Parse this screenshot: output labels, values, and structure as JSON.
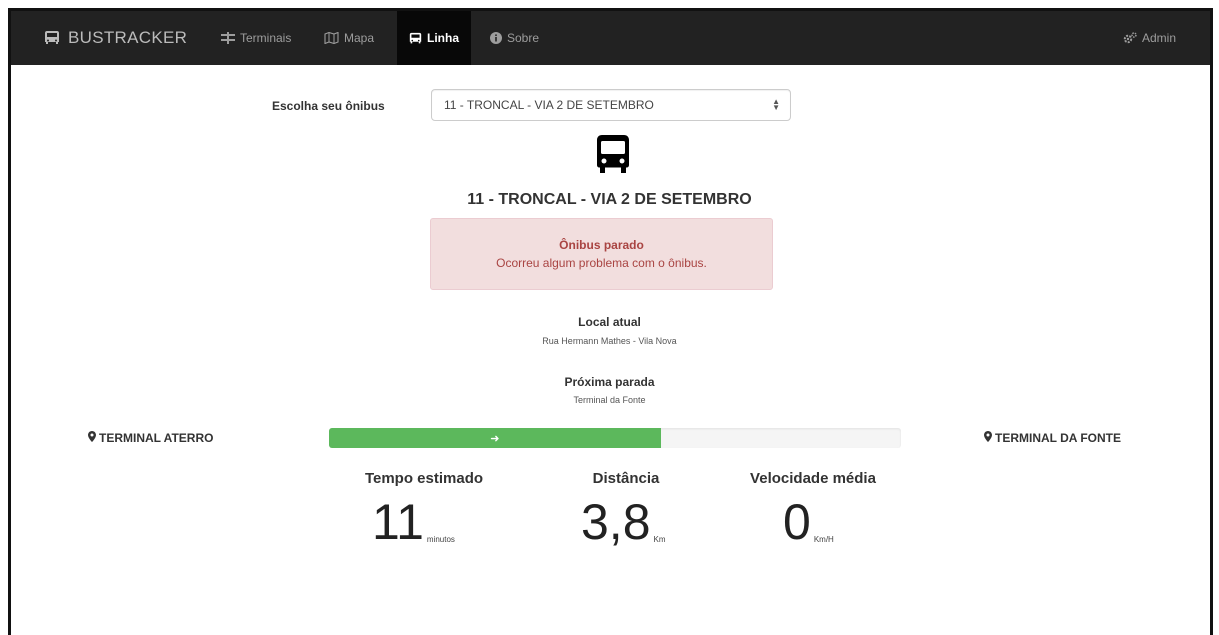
{
  "navbar": {
    "brand": "BUSTRACKER",
    "items": [
      {
        "label": "Terminais",
        "icon": "road-icon",
        "active": false
      },
      {
        "label": "Mapa",
        "icon": "map-icon",
        "active": false
      },
      {
        "label": "Linha",
        "icon": "bus-icon",
        "active": true
      },
      {
        "label": "Sobre",
        "icon": "info-icon",
        "active": false
      }
    ],
    "admin": "Admin",
    "colors": {
      "background": "#222222",
      "active_background": "#080808",
      "text": "#9d9d9d"
    }
  },
  "selector": {
    "label": "Escolha seu ônibus",
    "value": "11 - TRONCAL - VIA 2 DE SETEMBRO"
  },
  "route": {
    "title": "11 - TRONCAL - VIA 2 DE SETEMBRO"
  },
  "alert": {
    "title": "Ônibus parado",
    "message": "Ocorreu algum problema com o ônibus.",
    "colors": {
      "background": "#f2dede",
      "text": "#a94442"
    }
  },
  "current_location": {
    "label": "Local atual",
    "value": "Rua Hermann Mathes - Vila Nova"
  },
  "next_stop": {
    "label": "Próxima parada",
    "value": "Terminal da Fonte"
  },
  "trip": {
    "origin": "TERMINAL ATERRO",
    "destination": "TERMINAL DA FONTE",
    "progress_percent": 58,
    "progress_icon": "arrow-right-icon",
    "progress_color": "#5cb85c"
  },
  "metrics": [
    {
      "label": "Tempo estimado",
      "value": "11",
      "unit": "minutos"
    },
    {
      "label": "Distância",
      "value": "3,8",
      "unit": "Km"
    },
    {
      "label": "Velocidade média",
      "value": "0",
      "unit": "Km/H"
    }
  ]
}
